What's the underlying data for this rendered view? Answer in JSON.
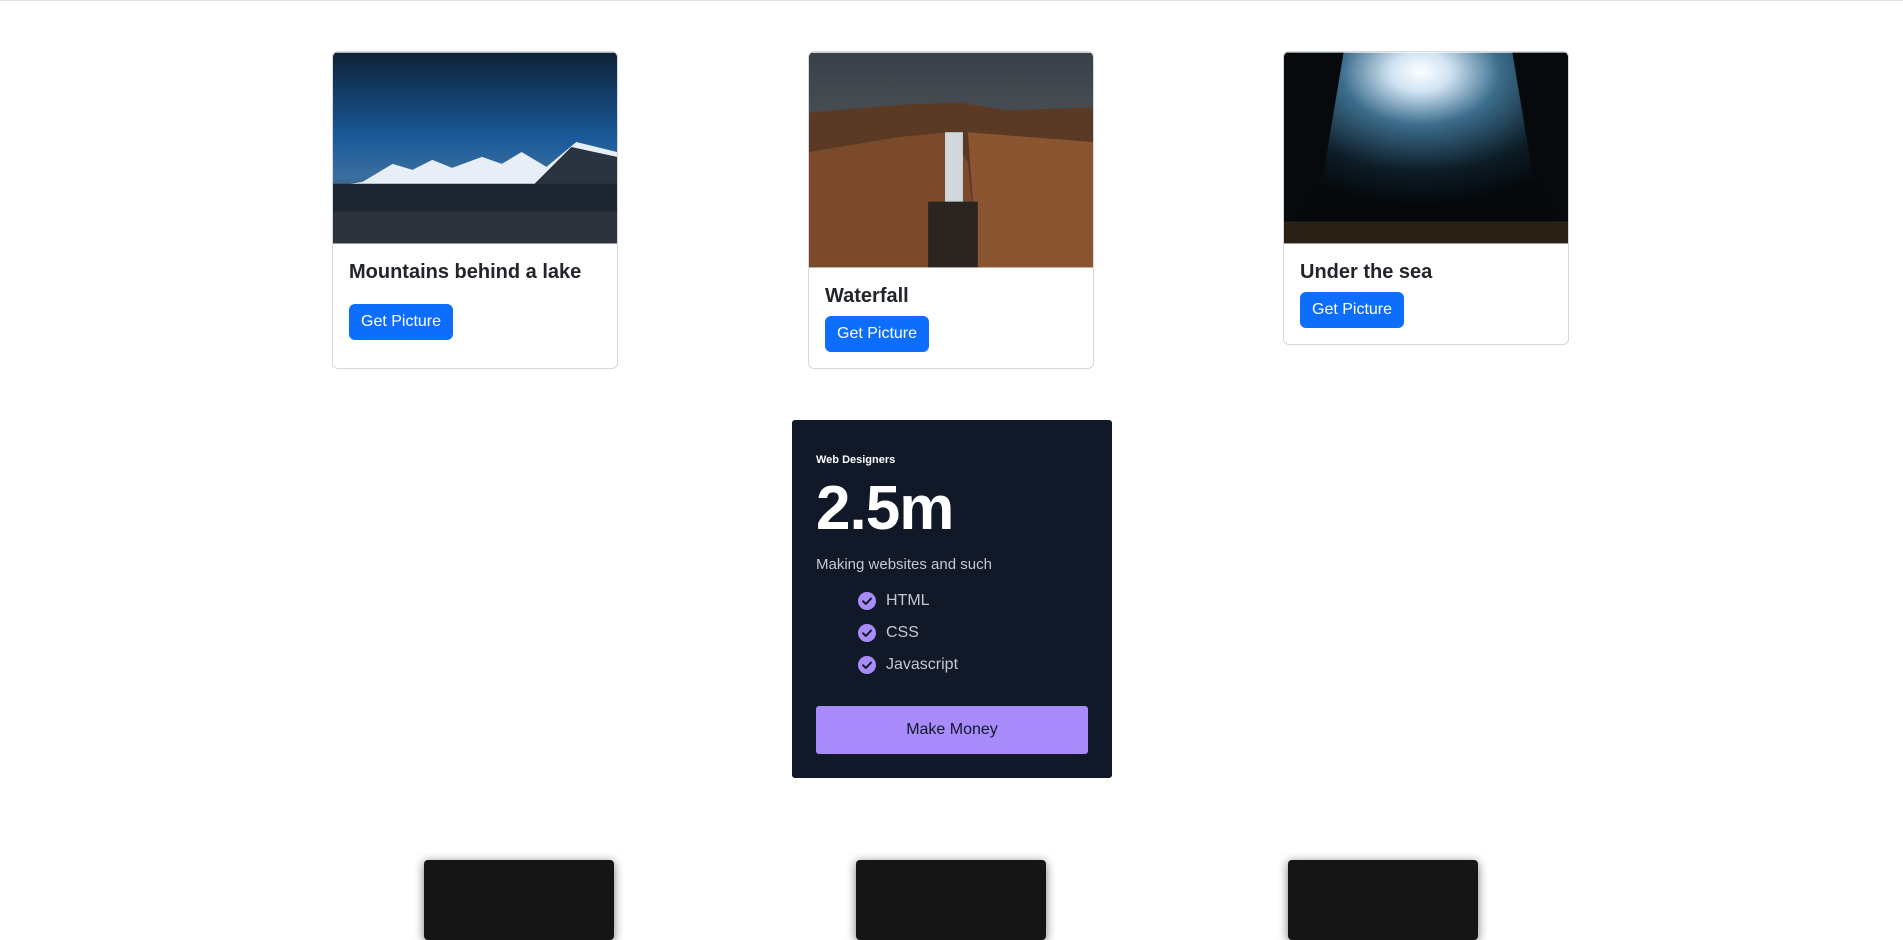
{
  "cards": [
    {
      "title": "Mountains behind a lake",
      "button_label": "Get Picture"
    },
    {
      "title": "Waterfall",
      "button_label": "Get Picture"
    },
    {
      "title": "Under the sea",
      "button_label": "Get Picture"
    }
  ],
  "pricing": {
    "kicker": "Web Designers",
    "number": "2.5m",
    "description": "Making websites and such",
    "features": [
      "HTML",
      "CSS",
      "Javascript"
    ],
    "button_label": "Make Money",
    "accent_color": "#a78bfa",
    "background_color": "#111827"
  },
  "colors": {
    "primary_button": "#0d6efd"
  }
}
